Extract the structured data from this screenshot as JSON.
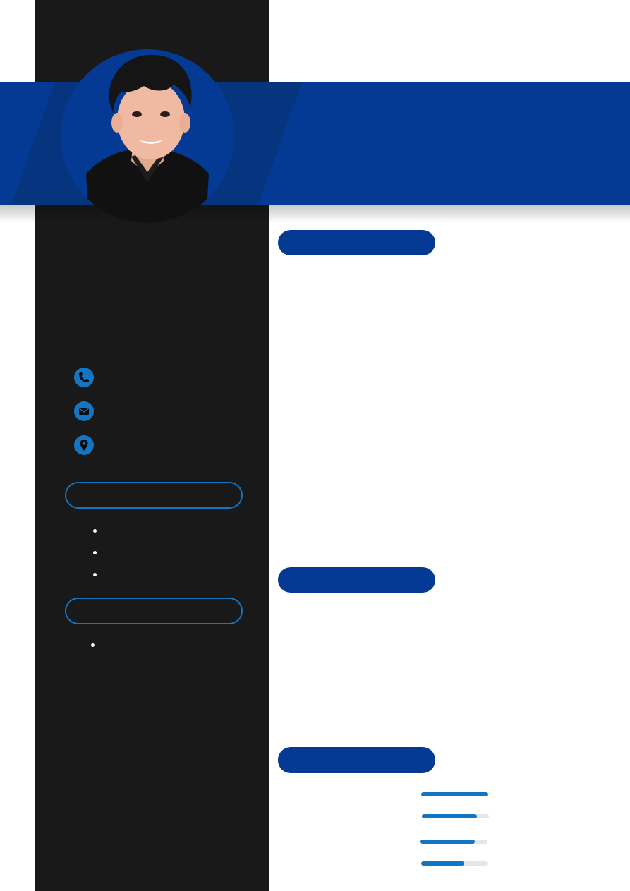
{
  "colors": {
    "sidebar": "#191919",
    "band": "#043a93",
    "accent": "#1276c5",
    "track": "#e3e7ea"
  },
  "photo": {
    "icon": "profile-photo"
  },
  "contacts": [
    {
      "icon": "phone-icon",
      "text": ""
    },
    {
      "icon": "mail-icon",
      "text": ""
    },
    {
      "icon": "location-pin-icon",
      "text": ""
    }
  ],
  "sidebar_sections": [
    {
      "title": "",
      "items": [
        "",
        "",
        ""
      ]
    },
    {
      "title": "",
      "items": [
        ""
      ]
    }
  ],
  "main_sections": [
    {
      "title": ""
    },
    {
      "title": ""
    },
    {
      "title": ""
    }
  ],
  "skills": [
    {
      "label": "",
      "level": 1.0
    },
    {
      "label": "",
      "level": 0.82
    },
    {
      "label": "",
      "level": 0.81
    },
    {
      "label": "",
      "level": 0.64
    }
  ]
}
